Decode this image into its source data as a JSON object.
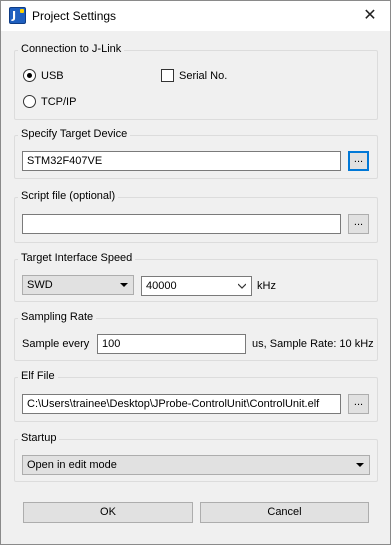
{
  "window": {
    "title": "Project Settings",
    "close_glyph": "✕",
    "app_icon": "jprobe-app-icon"
  },
  "connection": {
    "label": "Connection to J-Link",
    "usb_label": "USB",
    "usb_checked": true,
    "tcpip_label": "TCP/IP",
    "tcpip_checked": false,
    "serial_label": "Serial No.",
    "serial_checked": false
  },
  "target_device": {
    "label": "Specify Target Device",
    "value": "STM32F407VE",
    "browse_label": "..."
  },
  "script_file": {
    "label": "Script file (optional)",
    "value": "",
    "browse_label": "..."
  },
  "interface": {
    "label": "Target Interface  Speed",
    "interface_value": "SWD",
    "speed_value": "40000",
    "speed_unit": "kHz"
  },
  "sampling": {
    "label": "Sampling Rate",
    "prefix": "Sample every",
    "value": "100",
    "suffix": "us, Sample Rate: 10 kHz"
  },
  "elf_file": {
    "label": "Elf File",
    "value": "C:\\Users\\trainee\\Desktop\\JProbe-ControlUnit\\ControlUnit.elf",
    "browse_label": "..."
  },
  "startup": {
    "label": "Startup",
    "value": "Open in edit mode"
  },
  "footer": {
    "ok_label": "OK",
    "cancel_label": "Cancel"
  }
}
